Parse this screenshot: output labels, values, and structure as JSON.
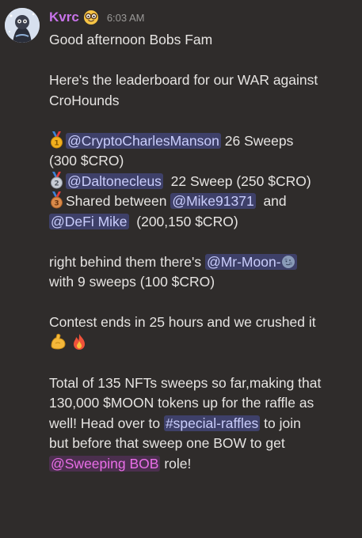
{
  "author": {
    "name": "Kvrc",
    "badge_icon": "nerd-face-emoji",
    "timestamp": "6:03 AM",
    "name_color": "#c873ea"
  },
  "message": {
    "greeting": "Good afternoon Bobs Fam",
    "intro_1": "Here's the leaderboard for our WAR against",
    "intro_2": "CroHounds",
    "first": {
      "medal_icon": "first-place-medal-icon",
      "mention": "@CryptoCharlesManson",
      "text_a": " 26 Sweeps",
      "text_b": "(300 $CRO)"
    },
    "second": {
      "medal_icon": "second-place-medal-icon",
      "mention": "@Daltonecleus",
      "text": "  22 Sweep (250 $CRO)"
    },
    "third": {
      "medal_icon": "third-place-medal-icon",
      "text_a": "Shared between ",
      "mention_a": "@Mike91371",
      "text_b": "  and",
      "mention_b": "@DeFi Mike",
      "text_c": "  (200,150 $CRO)"
    },
    "behind": {
      "text_a": "right behind them there's ",
      "mention": "@Mr-Moon-",
      "mention_icon": "moon-face-emoji",
      "text_b": "with 9 sweeps (100 $CRO)"
    },
    "contest": {
      "text": "Contest ends in 25 hours and we crushed it",
      "emoji_1": "flexed-biceps-emoji",
      "emoji_2": "fire-emoji"
    },
    "total": {
      "line_1": "Total of 135 NFTs sweeps so far,making that",
      "line_2": "130,000 $MOON tokens up for the raffle as",
      "line_3a": "well! Head over to ",
      "channel": "#special-raffles",
      "line_3b": " to join",
      "line_4": "but before that sweep one BOW to get",
      "role": "@Sweeping BOB",
      "line_5b": " role!"
    }
  },
  "colors": {
    "background": "#2f2c2b",
    "mention_bg": "#3e4069",
    "mention_text": "#c9cdfb",
    "role_bg": "#4b2f4e",
    "role_text": "#ea6ee8",
    "timestamp": "#9a9997"
  }
}
